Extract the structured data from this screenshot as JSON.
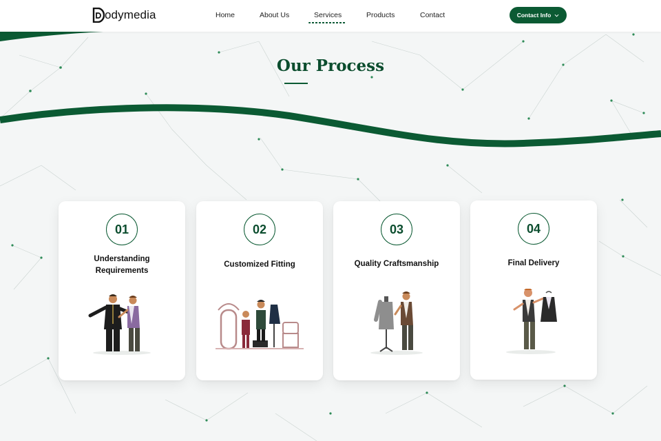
{
  "brand": {
    "logo_text": "odymedia"
  },
  "nav": {
    "items": [
      {
        "label": "Home"
      },
      {
        "label": "About Us"
      },
      {
        "label": "Services"
      },
      {
        "label": "Products"
      },
      {
        "label": "Contact"
      }
    ],
    "active": "Services"
  },
  "header": {
    "contact_label": "Contact Info",
    "contact_icon": "chevron-down-icon"
  },
  "section": {
    "title": "Our Process"
  },
  "steps": [
    {
      "number": "01",
      "title_line1": "Understanding",
      "title_line2": "Requirements",
      "illustration": "tailor-measuring-icon"
    },
    {
      "number": "02",
      "title_line1": "Customized Fitting",
      "title_line2": "",
      "illustration": "fitting-room-icon"
    },
    {
      "number": "03",
      "title_line1": "Quality Craftsmanship",
      "title_line2": "",
      "illustration": "mannequin-tailor-icon"
    },
    {
      "number": "04",
      "title_line1": "Final Delivery",
      "title_line2": "",
      "illustration": "suit-delivery-icon"
    }
  ],
  "colors": {
    "accent": "#0b5a33",
    "background": "#f4f6f6",
    "card": "#ffffff",
    "node": "#2e8b57"
  }
}
